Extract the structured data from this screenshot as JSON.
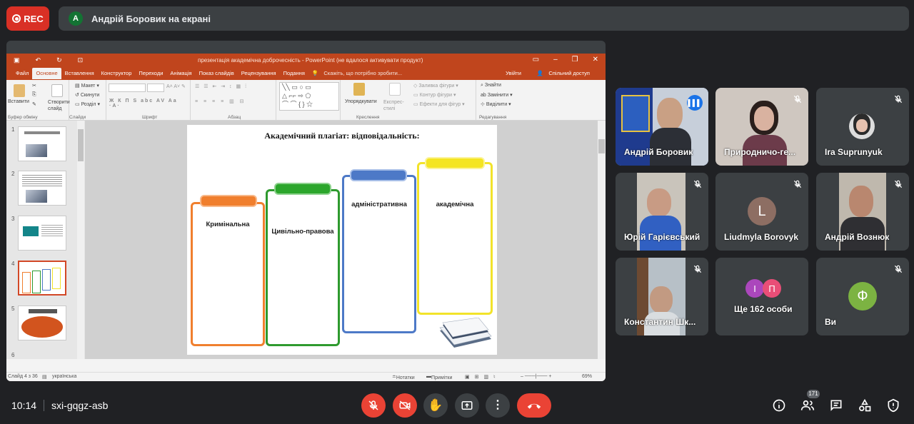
{
  "rec_label": "REC",
  "presenter": {
    "avatar_letter": "A",
    "text": "Андрій Боровик на екрані"
  },
  "ppt": {
    "window_title": "презентація академічна доброчесність - PowerPoint (не вдалося активувати продукт)",
    "tabs": [
      "Файл",
      "Основне",
      "Вставлення",
      "Конструктор",
      "Переходи",
      "Анімація",
      "Показ слайдів",
      "Рецензування",
      "Подання"
    ],
    "active_tab": "Основне",
    "tell_me": "Скажіть, що потрібно зробити...",
    "sign_in": "Увійти",
    "share": "Спільний доступ",
    "ribbon": {
      "paste": "Вставити",
      "create_slide": "Створити слайд",
      "layout": "Макет",
      "reset": "Скинути",
      "section": "Розділ",
      "arrange": "Упорядкувати",
      "express_styles": "Експрес-стилі",
      "fill": "Заливка фігури",
      "outline": "Контур фігури",
      "effects": "Ефекти для фігур",
      "find": "Знайти",
      "replace": "Замінити",
      "select": "Виділити",
      "groups": [
        "Буфер обміну",
        "Слайди",
        "Шрифт",
        "Абзац",
        "Креслення",
        "Редагування"
      ]
    },
    "slide_numbers": [
      "1",
      "2",
      "3",
      "4",
      "5",
      "6"
    ],
    "selected_slide": "4",
    "slide": {
      "title": "Академічний плагіат: відповідальність:",
      "cards": [
        "Кримінальна",
        "Цивільно-правова",
        "адміністративна",
        "академічна"
      ],
      "card_colors": [
        "#f07f2e",
        "#2e9a2e",
        "#4d79c7",
        "#f2e32a"
      ]
    },
    "status": {
      "slide_of": "Слайд 4 з 36",
      "language": "українська",
      "notes": "Нотатки",
      "comments": "Примітки",
      "zoom": "69%"
    }
  },
  "participants": [
    {
      "name": "Андрій Боровик",
      "speaking": true
    },
    {
      "name": "Природничо-ге..."
    },
    {
      "name": "Ira Suprunyuk"
    },
    {
      "name": "Юрій Гарієвський"
    },
    {
      "name": "Liudmyla Borovyk",
      "letter": "L",
      "color": "#8d6e63"
    },
    {
      "name": "Андрій Вознюк"
    },
    {
      "name": "Константин Шк..."
    },
    {
      "name": "Ще 162 особи",
      "letters": [
        "І",
        "П"
      ]
    },
    {
      "name": "Ви",
      "letter": "Ф",
      "color": "#7cb342"
    }
  ],
  "bottom": {
    "time": "10:14",
    "meeting_code": "sxi-gqgz-asb",
    "people_count": "171"
  }
}
